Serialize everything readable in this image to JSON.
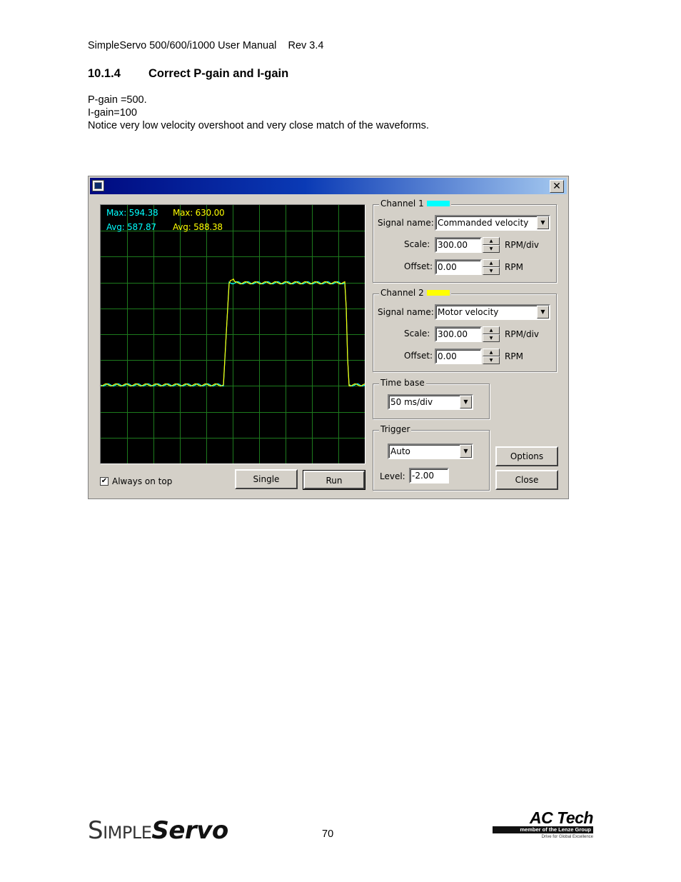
{
  "page": {
    "header": "SimpleServo 500/600/i1000 User Manual    Rev 3.4",
    "section_number": "10.1.4",
    "section_title": "Correct P-gain and I-gain",
    "lines": [
      "P-gain =500.",
      "I-gain=100",
      "Notice very low velocity overshoot and very close match of the waveforms."
    ],
    "page_number": "70"
  },
  "footer": {
    "logo_simple": "Simple",
    "logo_servo": "Servo",
    "actech_title": "AC Tech",
    "actech_member": "member of the Lenze Group",
    "actech_tagline": "Drive for Global Excellence"
  },
  "dialog": {
    "close_glyph": "✕",
    "ch1_max": "Max: 594.38",
    "ch1_avg": "Avg: 587.87",
    "ch2_max": "Max: 630.00",
    "ch2_avg": "Avg: 588.38",
    "always_on_top": "Always on top",
    "always_on_top_checked": true,
    "single_label": "Single",
    "run_label": "Run",
    "options_label": "Options",
    "close_label": "Close",
    "channel1": {
      "label": "Channel 1",
      "color": "#00ffff",
      "signal_label": "Signal name:",
      "signal_value": "Commanded velocity",
      "scale_label": "Scale:",
      "scale_value": "300.00",
      "scale_unit": "RPM/div",
      "offset_label": "Offset:",
      "offset_value": "0.00",
      "offset_unit": "RPM"
    },
    "channel2": {
      "label": "Channel 2",
      "color": "#ffff00",
      "signal_label": "Signal name:",
      "signal_value": "Motor velocity",
      "scale_label": "Scale:",
      "scale_value": "300.00",
      "scale_unit": "RPM/div",
      "offset_label": "Offset:",
      "offset_value": "0.00",
      "offset_unit": "RPM"
    },
    "time_base": {
      "label": "Time base",
      "value": "50 ms/div"
    },
    "trigger": {
      "label": "Trigger",
      "mode": "Auto",
      "level_label": "Level:",
      "level_value": "-2.00"
    }
  }
}
